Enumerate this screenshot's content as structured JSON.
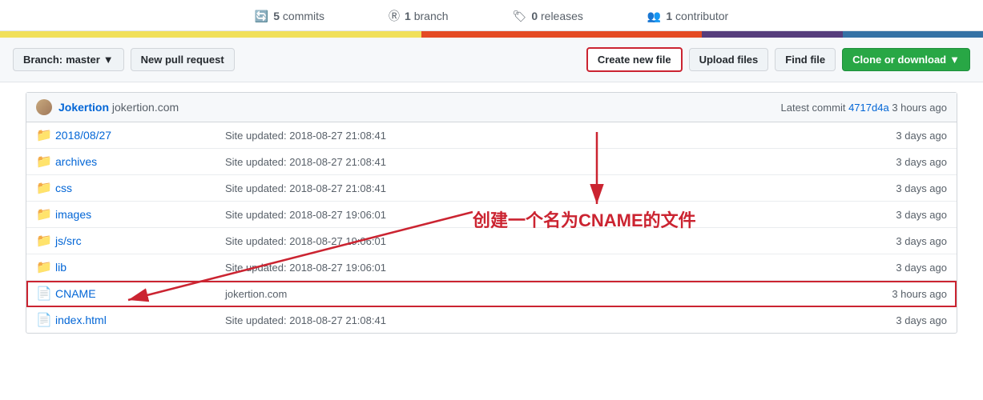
{
  "stats": {
    "commits": {
      "icon": "🔄",
      "count": "5",
      "label": "commits"
    },
    "branches": {
      "icon": "🔀",
      "count": "1",
      "label": "branch"
    },
    "releases": {
      "icon": "🏷",
      "count": "0",
      "label": "releases"
    },
    "contributors": {
      "icon": "👥",
      "count": "1",
      "label": "contributor"
    }
  },
  "toolbar": {
    "branch_label": "Branch:",
    "branch_name": "master",
    "new_pull_request": "New pull request",
    "create_new_file": "Create new file",
    "upload_files": "Upload files",
    "find_file": "Find file",
    "clone_download": "Clone or download"
  },
  "commit": {
    "author": "Jokertion",
    "domain": "jokertion.com",
    "hash_label": "Latest commit",
    "hash": "4717d4a",
    "time": "3 hours ago"
  },
  "files": [
    {
      "type": "folder",
      "name": "2018/08/27",
      "commit_msg": "Site updated: 2018-08-27 21:08:41",
      "time": "3 days ago"
    },
    {
      "type": "folder",
      "name": "archives",
      "commit_msg": "Site updated: 2018-08-27 21:08:41",
      "time": "3 days ago"
    },
    {
      "type": "folder",
      "name": "css",
      "commit_msg": "Site updated: 2018-08-27 21:08:41",
      "time": "3 days ago"
    },
    {
      "type": "folder",
      "name": "images",
      "commit_msg": "Site updated: 2018-08-27 19:06:01",
      "time": "3 days ago"
    },
    {
      "type": "folder",
      "name": "js/src",
      "commit_msg": "Site updated: 2018-08-27 19:06:01",
      "time": "3 days ago"
    },
    {
      "type": "folder",
      "name": "lib",
      "commit_msg": "Site updated: 2018-08-27 19:06:01",
      "time": "3 days ago"
    },
    {
      "type": "file",
      "name": "CNAME",
      "commit_msg": "jokertion.com",
      "time": "3 hours ago",
      "highlight": true
    },
    {
      "type": "file",
      "name": "index.html",
      "commit_msg": "Site updated: 2018-08-27 21:08:41",
      "time": "3 days ago"
    }
  ],
  "annotation": {
    "chinese_text": "创建一个名为CNAME的文件"
  }
}
